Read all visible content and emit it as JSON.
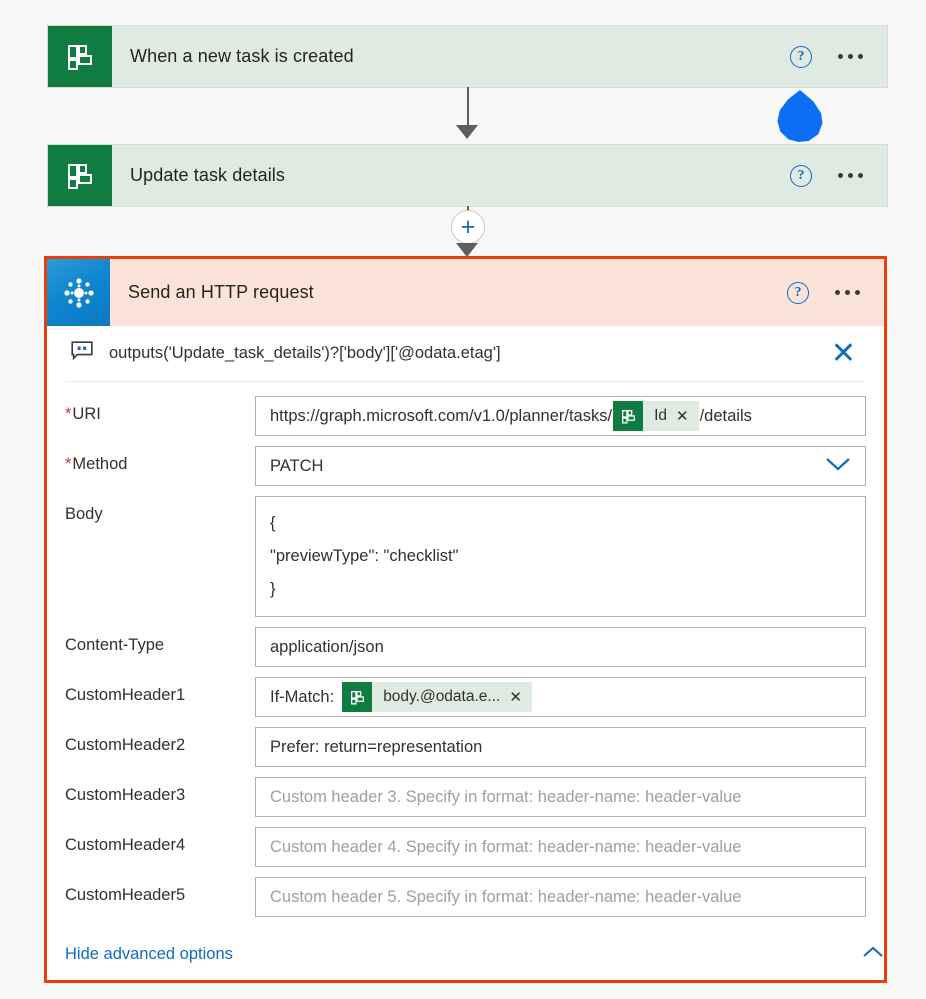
{
  "flow": {
    "steps": [
      {
        "title": "When a new task is created",
        "icon": "planner-icon",
        "help_icon": "help-icon",
        "menu_icon": "ellipsis-icon"
      },
      {
        "title": "Update task details",
        "icon": "planner-icon",
        "help_icon": "help-icon",
        "menu_icon": "ellipsis-icon"
      }
    ],
    "add_step_icon": "plus-icon",
    "cursor_icon": "droplet-cursor",
    "connector_arrow_icon": "arrow-down-icon"
  },
  "selected_action": {
    "title": "Send an HTTP request",
    "icon": "graph-icon",
    "help_icon": "help-icon",
    "menu_icon": "ellipsis-icon",
    "border_color": "#e8400c",
    "header_bg": "#fbe3da",
    "expression": {
      "icon": "comment-bubble-icon",
      "text": "outputs('Update_task_details')?['body']['@odata.etag']",
      "close_icon": "close-icon"
    },
    "fields": {
      "uri": {
        "label": "URI",
        "required": true,
        "prefix": "https://graph.microsoft.com/v1.0/planner/tasks/",
        "token": {
          "icon": "planner-icon",
          "label": "Id",
          "remove_icon": "remove-token-icon"
        },
        "suffix": "/details"
      },
      "method": {
        "label": "Method",
        "required": true,
        "value": "PATCH",
        "chevron_icon": "chevron-down-icon"
      },
      "body": {
        "label": "Body",
        "required": false,
        "lines": [
          "{",
          "\"previewType\": \"checklist\"",
          "}"
        ]
      },
      "content_type": {
        "label": "Content-Type",
        "required": false,
        "value": "application/json"
      },
      "custom_header_1": {
        "label": "CustomHeader1",
        "required": false,
        "prefix": "If-Match:",
        "token": {
          "icon": "planner-icon",
          "label": "body.@odata.e...",
          "remove_icon": "remove-token-icon"
        }
      },
      "custom_header_2": {
        "label": "CustomHeader2",
        "required": false,
        "value": "Prefer: return=representation"
      },
      "custom_header_3": {
        "label": "CustomHeader3",
        "required": false,
        "placeholder": "Custom header 3. Specify in format: header-name: header-value"
      },
      "custom_header_4": {
        "label": "CustomHeader4",
        "required": false,
        "placeholder": "Custom header 4. Specify in format: header-name: header-value"
      },
      "custom_header_5": {
        "label": "CustomHeader5",
        "required": false,
        "placeholder": "Custom header 5. Specify in format: header-name: header-value"
      }
    },
    "advanced_options": {
      "label": "Hide advanced options",
      "chevron_icon": "chevron-up-icon"
    }
  },
  "colors": {
    "planner_green": "#107c41",
    "card_bg": "#dfeae2",
    "accent_blue": "#0f6cbd",
    "selection_red": "#e8400c"
  }
}
